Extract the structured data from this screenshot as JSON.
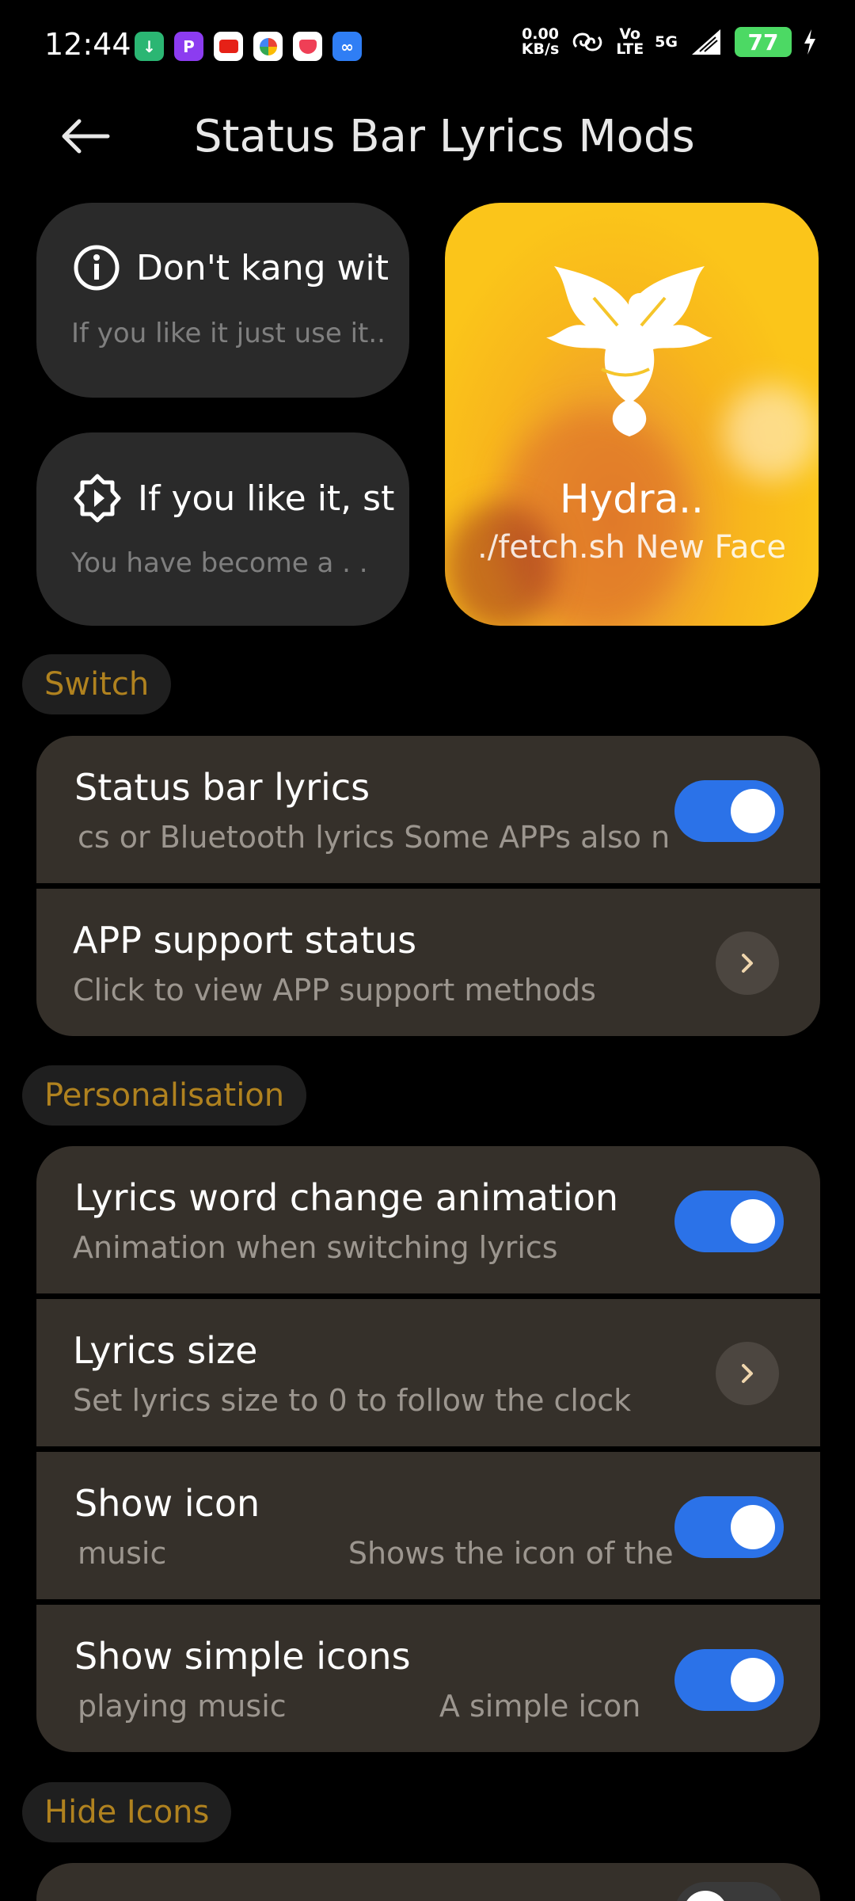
{
  "status_bar": {
    "time": "12:44",
    "net_speed_value": "0.00",
    "net_speed_unit": "KB/s",
    "volte_top": "Vo",
    "volte_bottom": "LTE",
    "network": "5G",
    "battery": "77"
  },
  "header": {
    "title": "Status Bar Lyrics Mods"
  },
  "cards": {
    "warning": {
      "title": "Don't kang wit",
      "subtitle": "If you like it just use it.."
    },
    "star": {
      "title": "If you like it, st",
      "subtitle": "You have become a . ."
    },
    "banner": {
      "title": "Hydra..",
      "subtitle": "./fetch.sh New Face"
    }
  },
  "sections": {
    "switch": {
      "label": "Switch",
      "items": [
        {
          "title": "Status bar lyrics",
          "subtitle": "cs or Bluetooth lyrics Some APPs also n",
          "control": "toggle",
          "on": true
        },
        {
          "title": "APP support status",
          "subtitle": "Click to view APP support methods",
          "control": "chevron"
        }
      ]
    },
    "personalisation": {
      "label": "Personalisation",
      "items": [
        {
          "title": "Lyrics word change animation",
          "subtitle": "Animation when switching lyrics",
          "control": "toggle",
          "on": true
        },
        {
          "title": "Lyrics size",
          "subtitle": "Set lyrics size to 0 to follow the clock",
          "control": "chevron"
        },
        {
          "title": "Show icon",
          "subtitle": "music                   Shows the icon of the",
          "control": "toggle",
          "on": true
        },
        {
          "title": "Show simple icons",
          "subtitle": "playing music                A simple icon",
          "control": "toggle",
          "on": true
        }
      ]
    },
    "hide_icons": {
      "label": "Hide Icons"
    }
  },
  "colors": {
    "accent_toggle": "#2b72e8",
    "section_label": "#b0821f",
    "card_bg": "#35302a",
    "battery": "#4cd964"
  }
}
